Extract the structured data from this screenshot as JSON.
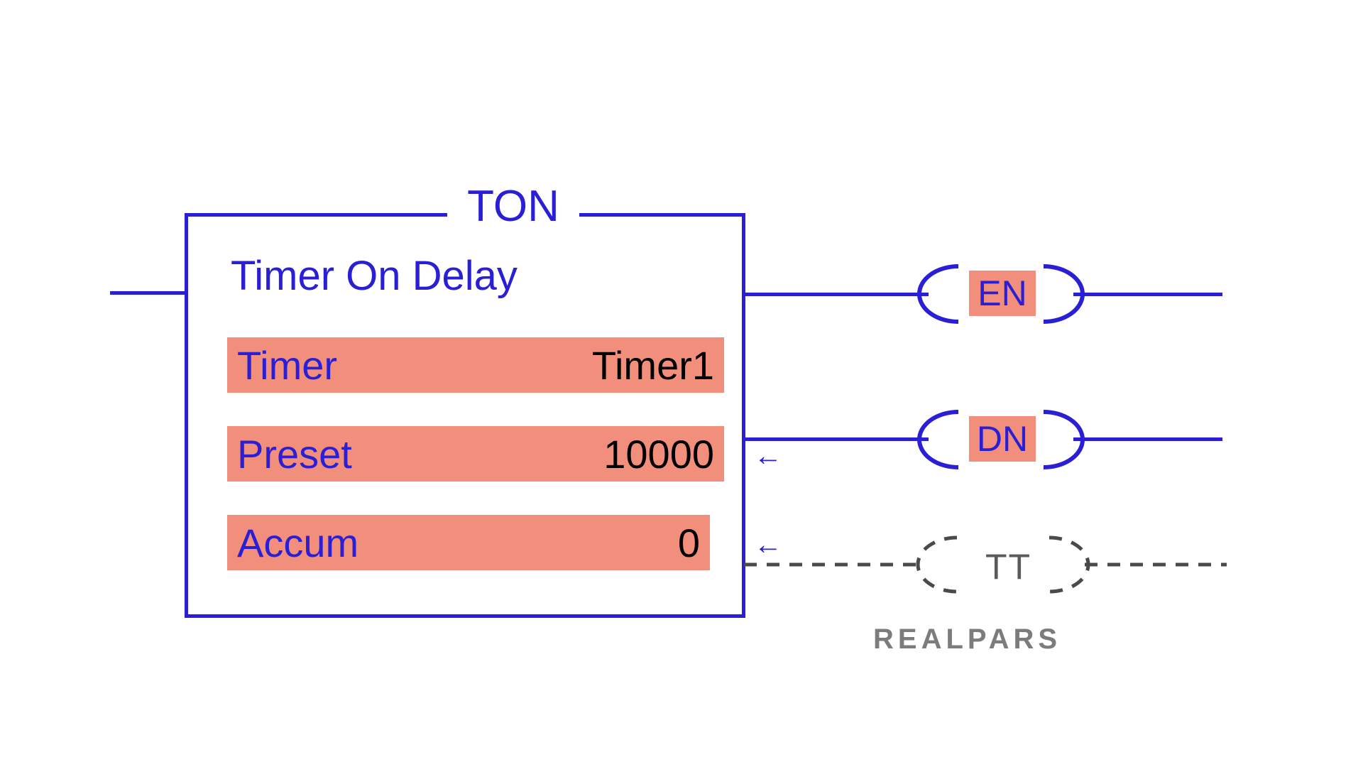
{
  "block": {
    "code": "TON",
    "subtitle": "Timer On Delay",
    "rows": {
      "timer": {
        "label": "Timer",
        "value": "Timer1"
      },
      "preset": {
        "label": "Preset",
        "value": "10000"
      },
      "accum": {
        "label": "Accum",
        "value": "0"
      }
    },
    "arrows": {
      "preset": "←",
      "accum": "←"
    }
  },
  "outputs": {
    "en": "EN",
    "dn": "DN",
    "tt": "TT"
  },
  "watermark": "REALPARS"
}
